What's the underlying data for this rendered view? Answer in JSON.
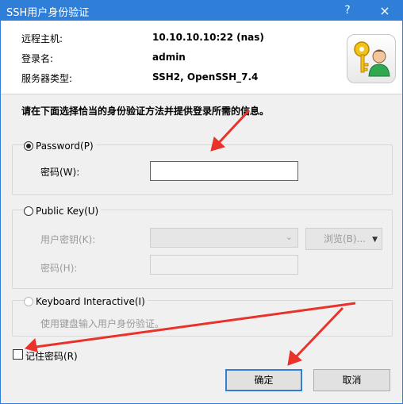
{
  "window": {
    "title": "SSH用户身份验证",
    "help_label": "?",
    "close_label": "×"
  },
  "info": {
    "host_label": "远程主机:",
    "host_value": "10.10.10.10:22 (nas)",
    "username_label": "登录名:",
    "username_value": "admin",
    "server_type_label": "服务器类型:",
    "server_type_value": "SSH2, OpenSSH_7.4",
    "icon": "key-user-icon"
  },
  "instruction": "请在下面选择恰当的身份验证方法并提供登录所需的信息。",
  "password_group": {
    "title": "Password(P)",
    "selected": true,
    "password_label": "密码(W):",
    "password_value": ""
  },
  "public_key_group": {
    "title": "Public Key(U)",
    "selected": false,
    "key_label": "用户密钥(K):",
    "key_value": "",
    "browse_label": "浏览(B)...",
    "passphrase_label": "密码(H):",
    "passphrase_value": ""
  },
  "keyboard_group": {
    "title": "Keyboard Interactive(I)",
    "selected": false,
    "description": "使用键盘输入用户身份验证。"
  },
  "remember_password": {
    "label": "记住密码(R)",
    "checked": false
  },
  "buttons": {
    "ok": "确定",
    "cancel": "取消"
  },
  "colors": {
    "titlebar": "#2f7fd8",
    "annotation_arrow": "#e8322a"
  }
}
